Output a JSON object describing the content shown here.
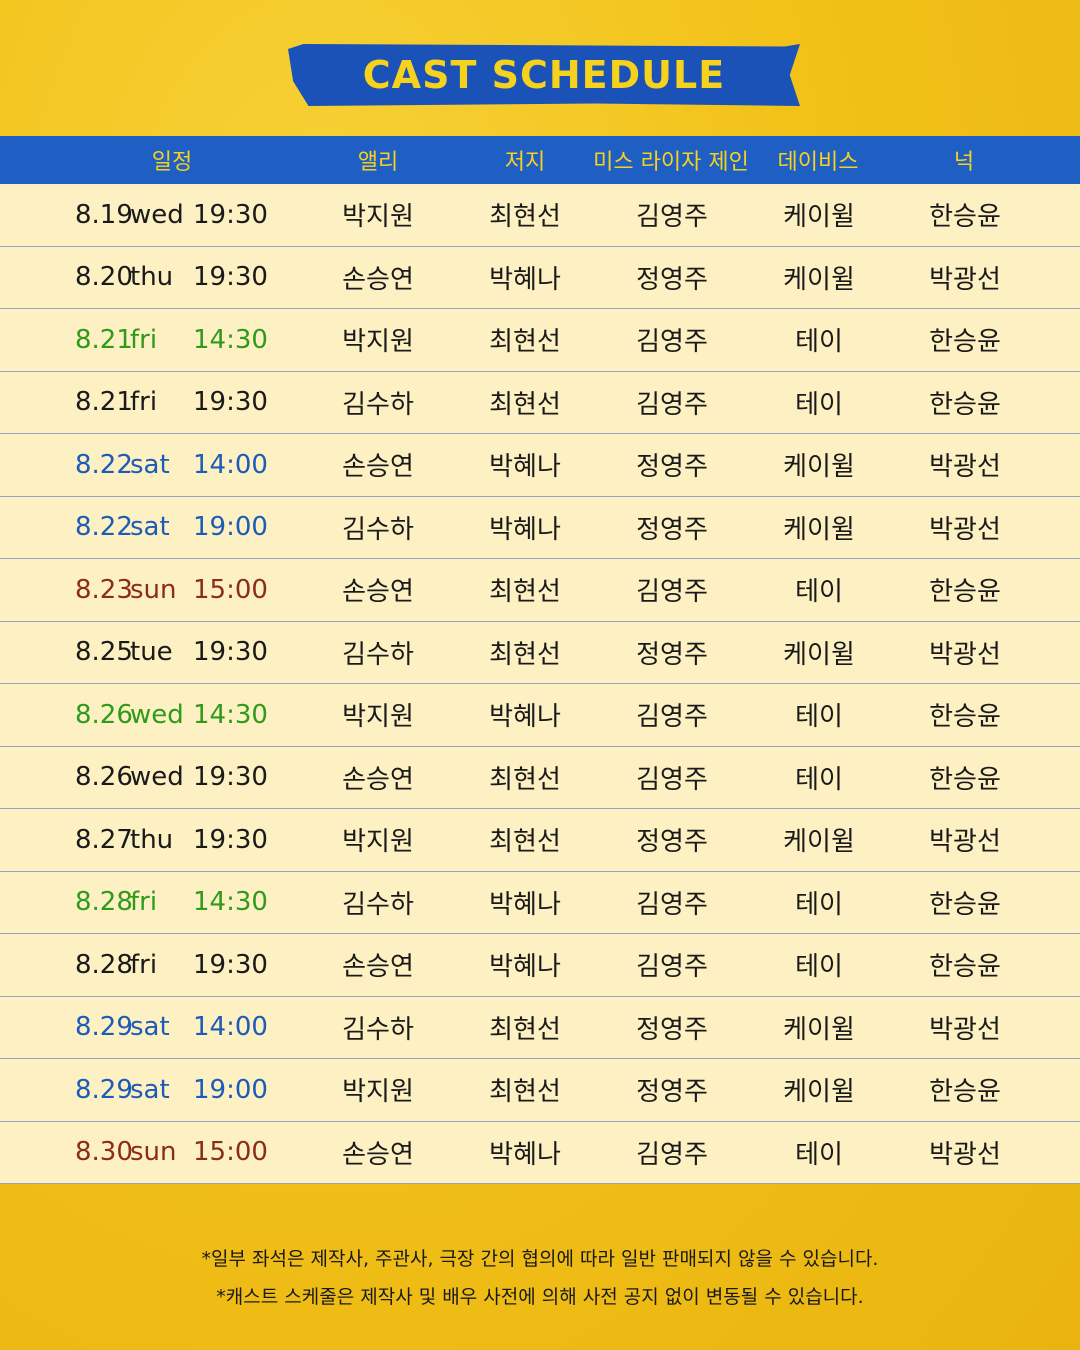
{
  "title": "CAST SCHEDULE",
  "headers": [
    "일정",
    "앨리",
    "저지",
    "미스 라이자 제인",
    "데이비스",
    "넉"
  ],
  "rows": [
    {
      "date": "8.19",
      "day": "wed",
      "time": "19:30",
      "tone": "",
      "cast": [
        "박지원",
        "최현선",
        "김영주",
        "케이윌",
        "한승윤"
      ]
    },
    {
      "date": "8.20",
      "day": "thu",
      "time": "19:30",
      "tone": "",
      "cast": [
        "손승연",
        "박혜나",
        "정영주",
        "케이윌",
        "박광선"
      ]
    },
    {
      "date": "8.21",
      "day": "fri",
      "time": "14:30",
      "tone": "green",
      "cast": [
        "박지원",
        "최현선",
        "김영주",
        "테이",
        "한승윤"
      ]
    },
    {
      "date": "8.21",
      "day": "fri",
      "time": "19:30",
      "tone": "",
      "cast": [
        "김수하",
        "최현선",
        "김영주",
        "테이",
        "한승윤"
      ]
    },
    {
      "date": "8.22",
      "day": "sat",
      "time": "14:00",
      "tone": "blue",
      "cast": [
        "손승연",
        "박혜나",
        "정영주",
        "케이윌",
        "박광선"
      ]
    },
    {
      "date": "8.22",
      "day": "sat",
      "time": "19:00",
      "tone": "blue",
      "cast": [
        "김수하",
        "박혜나",
        "정영주",
        "케이윌",
        "박광선"
      ]
    },
    {
      "date": "8.23",
      "day": "sun",
      "time": "15:00",
      "tone": "red",
      "cast": [
        "손승연",
        "최현선",
        "김영주",
        "테이",
        "한승윤"
      ]
    },
    {
      "date": "8.25",
      "day": "tue",
      "time": "19:30",
      "tone": "",
      "cast": [
        "김수하",
        "최현선",
        "정영주",
        "케이윌",
        "박광선"
      ]
    },
    {
      "date": "8.26",
      "day": "wed",
      "time": "14:30",
      "tone": "green",
      "cast": [
        "박지원",
        "박혜나",
        "김영주",
        "테이",
        "한승윤"
      ]
    },
    {
      "date": "8.26",
      "day": "wed",
      "time": "19:30",
      "tone": "",
      "cast": [
        "손승연",
        "최현선",
        "김영주",
        "테이",
        "한승윤"
      ]
    },
    {
      "date": "8.27",
      "day": "thu",
      "time": "19:30",
      "tone": "",
      "cast": [
        "박지원",
        "최현선",
        "정영주",
        "케이윌",
        "박광선"
      ]
    },
    {
      "date": "8.28",
      "day": "fri",
      "time": "14:30",
      "tone": "green",
      "cast": [
        "김수하",
        "박혜나",
        "김영주",
        "테이",
        "한승윤"
      ]
    },
    {
      "date": "8.28",
      "day": "fri",
      "time": "19:30",
      "tone": "",
      "cast": [
        "손승연",
        "박혜나",
        "김영주",
        "테이",
        "한승윤"
      ]
    },
    {
      "date": "8.29",
      "day": "sat",
      "time": "14:00",
      "tone": "blue",
      "cast": [
        "김수하",
        "최현선",
        "정영주",
        "케이윌",
        "박광선"
      ]
    },
    {
      "date": "8.29",
      "day": "sat",
      "time": "19:00",
      "tone": "blue",
      "cast": [
        "박지원",
        "최현선",
        "정영주",
        "케이윌",
        "한승윤"
      ]
    },
    {
      "date": "8.30",
      "day": "sun",
      "time": "15:00",
      "tone": "red",
      "cast": [
        "손승연",
        "박혜나",
        "김영주",
        "테이",
        "박광선"
      ]
    }
  ],
  "notes": [
    "*일부 좌석은 제작사, 주관사, 극장 간의 협의에 따라 일반 판매되지 않을 수 있습니다.",
    "*캐스트 스케줄은 제작사 및 배우 사전에 의해 사전 공지 없이 변동될 수 있습니다."
  ],
  "colors": {
    "header_bg": "#1f5fc4",
    "header_text": "#f7d21c",
    "green": "#2f9a1c",
    "blue": "#1c5cb8",
    "red": "#8a2d1c"
  }
}
